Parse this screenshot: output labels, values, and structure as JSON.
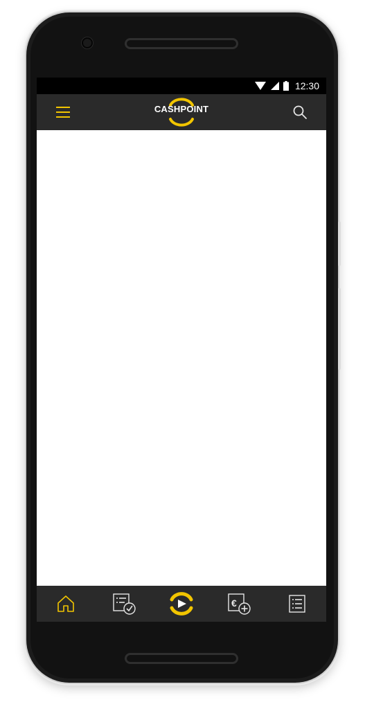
{
  "status_bar": {
    "time": "12:30",
    "icons": [
      "wifi-icon",
      "cell-signal-icon",
      "battery-icon"
    ]
  },
  "app_bar": {
    "logo_text": "CASHPOINT",
    "menu_icon": "hamburger-menu-icon",
    "search_icon": "search-icon"
  },
  "bottom_nav": {
    "items": [
      {
        "icon": "home-icon",
        "active": true
      },
      {
        "icon": "bet-slip-check-icon",
        "active": false
      },
      {
        "icon": "play-logo-icon",
        "active": false
      },
      {
        "icon": "deposit-euro-icon",
        "active": false
      },
      {
        "icon": "list-icon",
        "active": false
      }
    ]
  },
  "colors": {
    "brand_yellow": "#f2c500",
    "bar_dark": "#2a2a2a",
    "icon_light": "#e6e6e6"
  }
}
